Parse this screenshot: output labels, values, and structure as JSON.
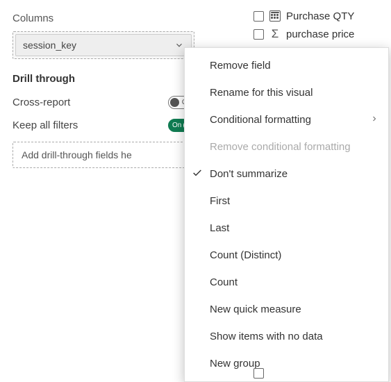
{
  "leftPane": {
    "columnsHeader": "Columns",
    "columnField": "session_key",
    "drillHeader": "Drill through",
    "crossReport": {
      "label": "Cross-report",
      "stateLabel": "Off"
    },
    "keepFilters": {
      "label": "Keep all filters",
      "stateLabel": "On"
    },
    "drillDropPlaceholder": "Add drill-through fields he"
  },
  "fieldsList": {
    "items": [
      {
        "label": "Purchase QTY",
        "iconType": "calc"
      },
      {
        "label": "purchase price",
        "iconType": "sigma"
      }
    ]
  },
  "contextMenu": {
    "items": [
      {
        "label": "Remove field",
        "disabled": false,
        "checked": false,
        "hasSubmenu": false
      },
      {
        "label": "Rename for this visual",
        "disabled": false,
        "checked": false,
        "hasSubmenu": false
      },
      {
        "label": "Conditional formatting",
        "disabled": false,
        "checked": false,
        "hasSubmenu": true
      },
      {
        "label": "Remove conditional formatting",
        "disabled": true,
        "checked": false,
        "hasSubmenu": false
      },
      {
        "label": "Don't summarize",
        "disabled": false,
        "checked": true,
        "hasSubmenu": false
      },
      {
        "label": "First",
        "disabled": false,
        "checked": false,
        "hasSubmenu": false
      },
      {
        "label": "Last",
        "disabled": false,
        "checked": false,
        "hasSubmenu": false
      },
      {
        "label": "Count (Distinct)",
        "disabled": false,
        "checked": false,
        "hasSubmenu": false
      },
      {
        "label": "Count",
        "disabled": false,
        "checked": false,
        "hasSubmenu": false
      },
      {
        "label": "New quick measure",
        "disabled": false,
        "checked": false,
        "hasSubmenu": false
      },
      {
        "label": "Show items with no data",
        "disabled": false,
        "checked": false,
        "hasSubmenu": false
      },
      {
        "label": "New group",
        "disabled": false,
        "checked": false,
        "hasSubmenu": false
      }
    ]
  }
}
